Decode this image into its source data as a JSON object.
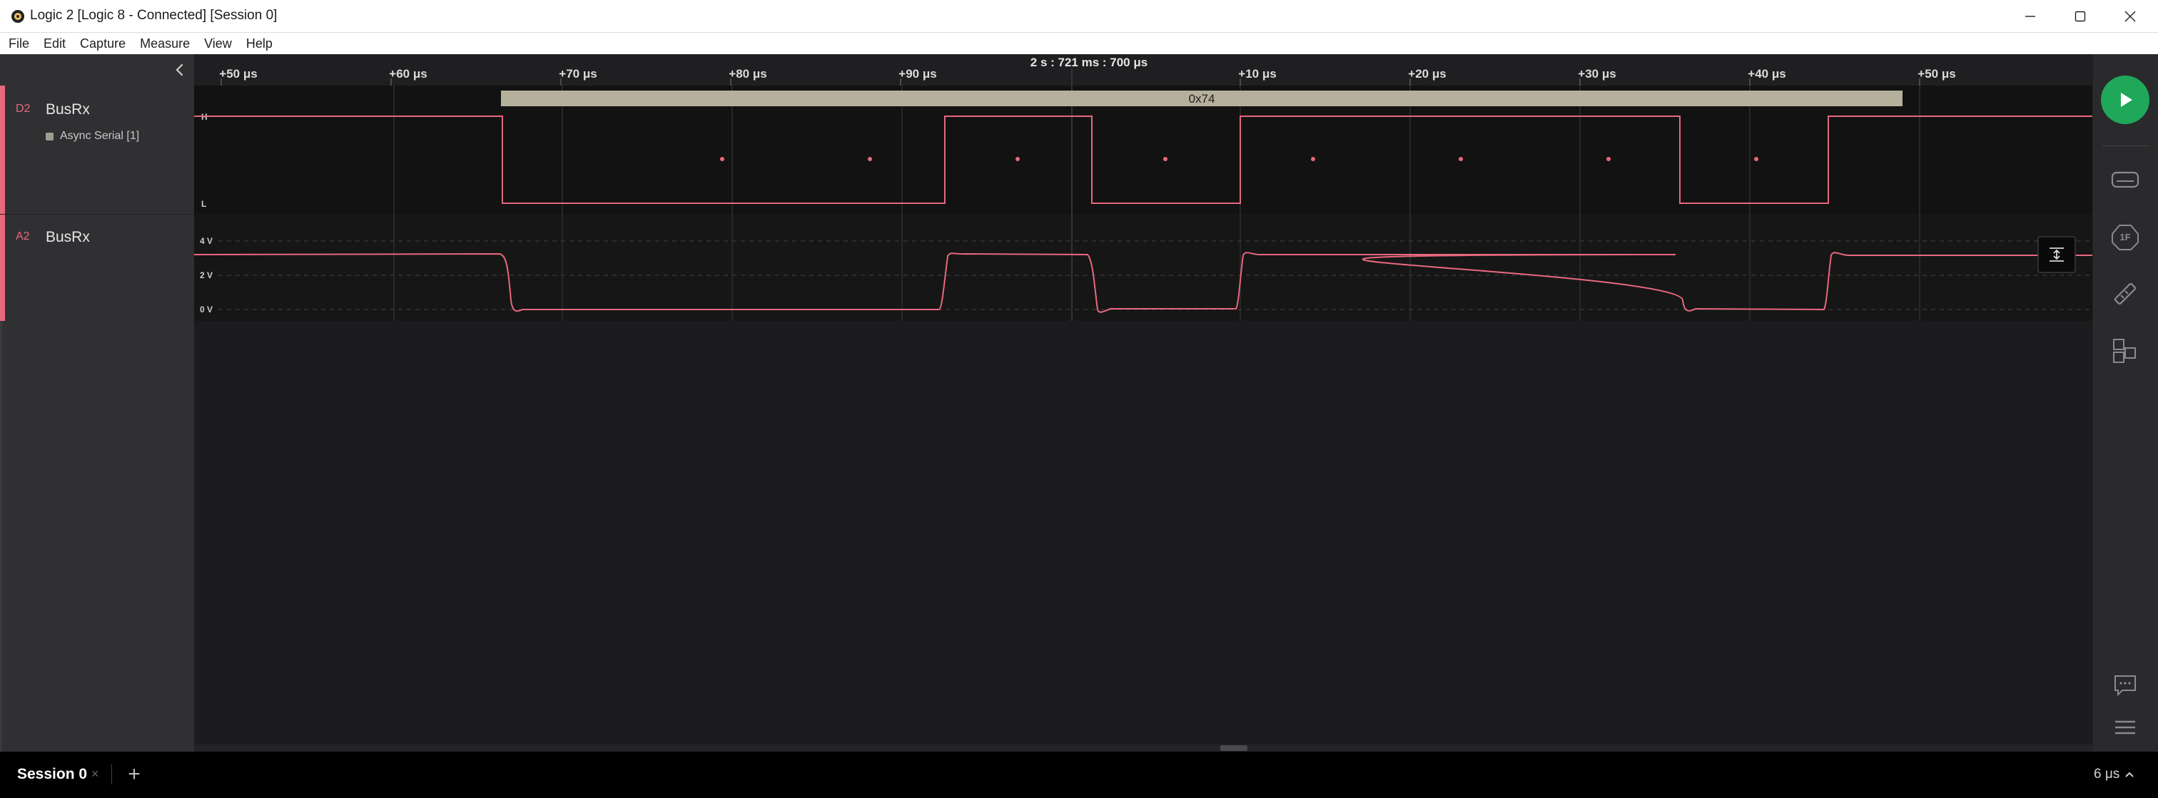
{
  "window": {
    "title": "Logic 2 [Logic 8 - Connected] [Session 0]"
  },
  "menu": {
    "items": [
      "File",
      "Edit",
      "Capture",
      "Measure",
      "View",
      "Help"
    ]
  },
  "timeline": {
    "center_time": "2 s : 721 ms : 700 μs",
    "ticks": [
      "+50 μs",
      "+60 μs",
      "+70 μs",
      "+80 μs",
      "+90 μs",
      "+10 μs",
      "+20 μs",
      "+30 μs",
      "+40 μs",
      "+50 μs"
    ]
  },
  "channels": [
    {
      "id": "D2",
      "name": "BusRx",
      "analyzer": "Async Serial [1]",
      "decoded_value": "0x74",
      "level_high": "H",
      "level_low": "L"
    },
    {
      "id": "A2",
      "name": "BusRx",
      "scale_labels": [
        "4 V",
        "2 V",
        "0 V"
      ]
    }
  ],
  "sessions": [
    {
      "name": "Session 0",
      "close_glyph": "×"
    }
  ],
  "add_session_glyph": "+",
  "timescale": "6 μs",
  "icons": {
    "app": "logic-app-icon",
    "collapse": "chevron-left-icon",
    "start": "play-icon",
    "sidebar": [
      "analyzers-icon",
      "extensions-icon",
      "measurements-icon",
      "layout-icon",
      "notes-icon",
      "menu-icon"
    ]
  },
  "colors": {
    "accent": "#e8687e",
    "start_button": "#1fa85a",
    "decoder_frame": "#b5b09c"
  }
}
